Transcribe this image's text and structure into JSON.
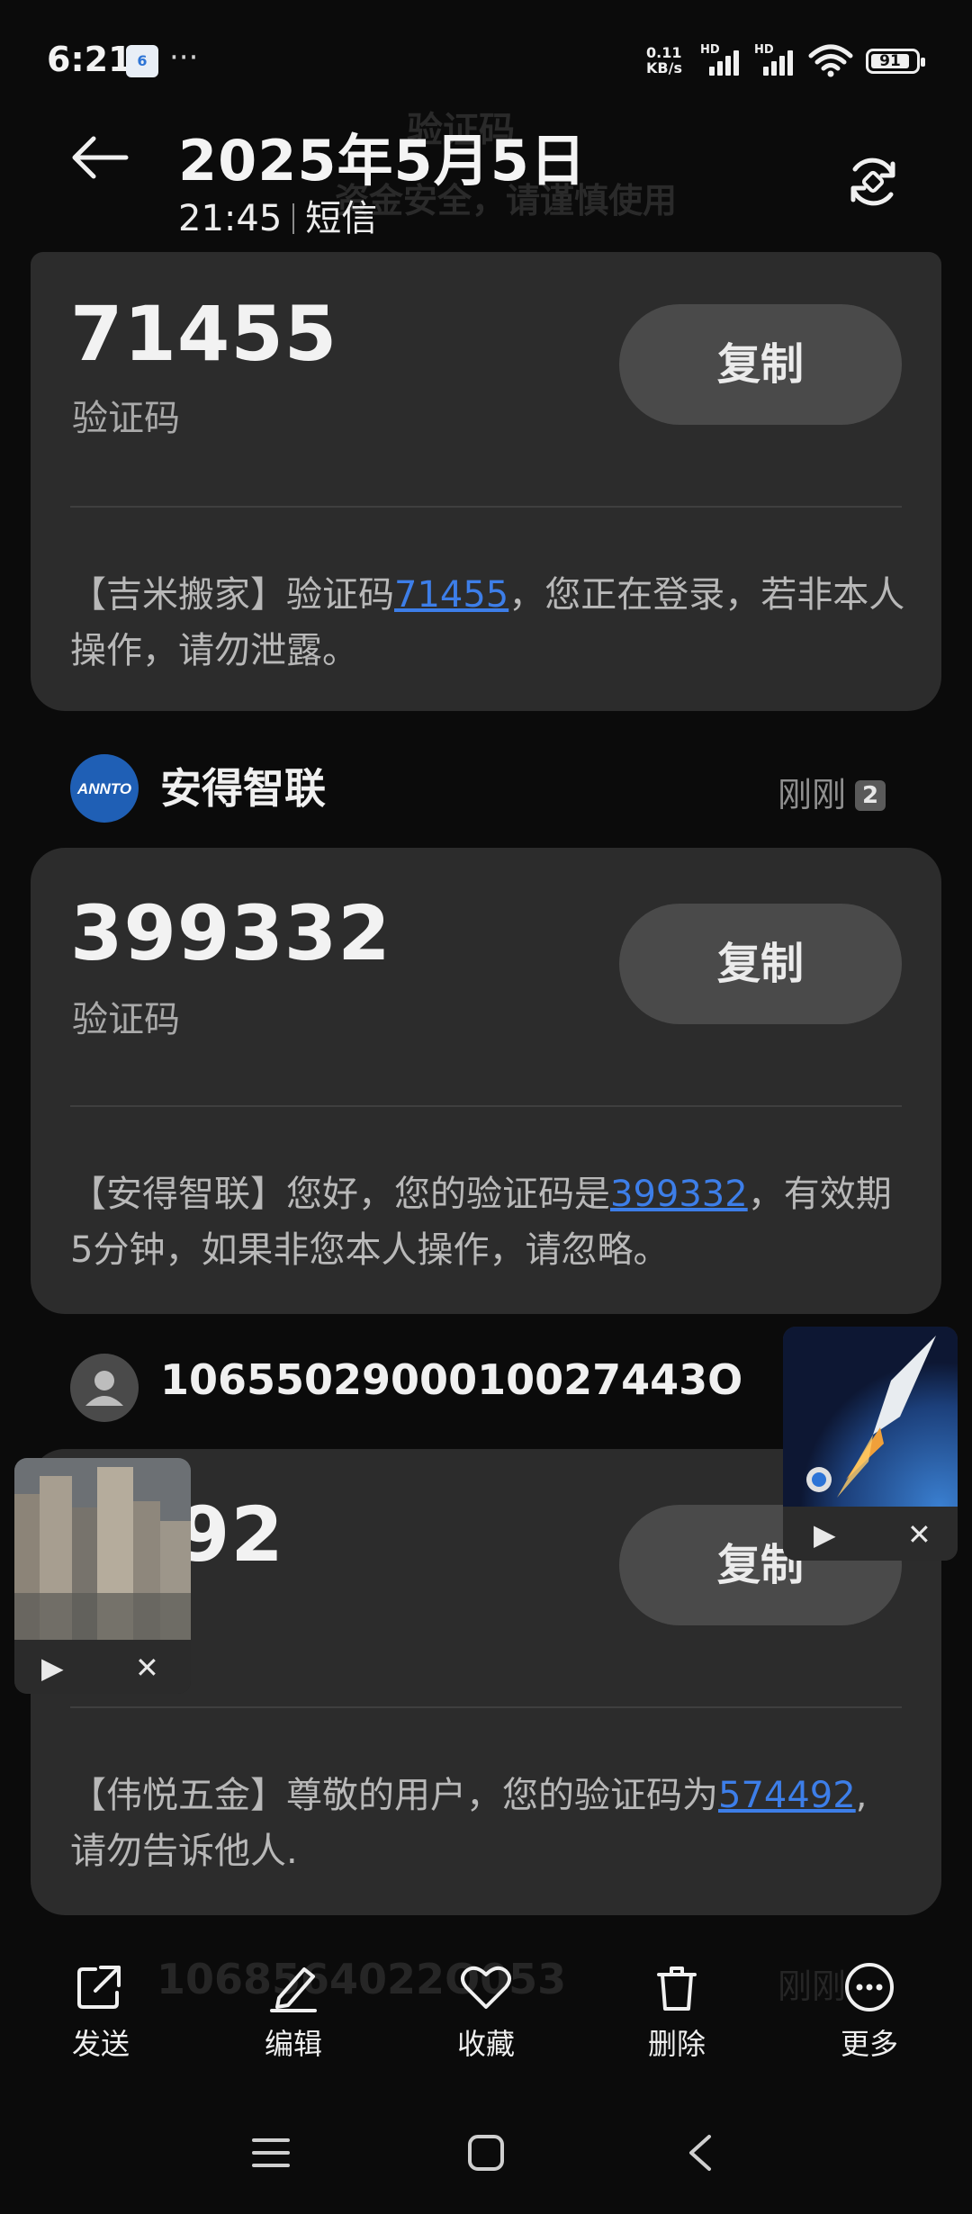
{
  "status_bar": {
    "time": "6:21",
    "mini_badge": "6",
    "more_dots": "···",
    "net_speed_value": "0.11",
    "net_speed_unit": "KB/s",
    "hd1": "HD",
    "hd2": "HD",
    "battery": "91"
  },
  "header": {
    "ghost_title": "验证码",
    "ghost_subtitle": "资金安全，请谨慎使用",
    "date": "2025年5月5日",
    "time": "21:45",
    "channel": "短信"
  },
  "cards": [
    {
      "code": "71455",
      "code_label": "验证码",
      "copy_label": "复制",
      "msg_prefix": "【吉米搬家】验证码",
      "msg_link": "71455",
      "msg_suffix": "，您正在登录，若非本人操作，请勿泄露。"
    },
    {
      "code": "399332",
      "code_label": "验证码",
      "copy_label": "复制",
      "msg_prefix": "【安得智联】您好，您的验证码是",
      "msg_link": "399332",
      "msg_suffix": "，有效期5分钟，如果非您本人操作，请忽略。"
    },
    {
      "code": "4492",
      "code_label": "",
      "copy_label": "复制",
      "msg_prefix": "【伟悦五金】尊敬的用户，您的验证码为",
      "msg_link": "574492",
      "msg_suffix": ", 请勿告诉他人."
    }
  ],
  "senders": [
    {
      "name": "安得智联",
      "logo_text": "ANNTO",
      "time": "刚刚",
      "count": "2"
    },
    {
      "name": "1065502900010027443O",
      "time": ""
    }
  ],
  "next_sender_ghost": "1068564022O053",
  "next_sender_time_ghost": "刚刚",
  "actions": [
    {
      "label": "发送",
      "icon": "share-icon"
    },
    {
      "label": "编辑",
      "icon": "edit-icon"
    },
    {
      "label": "收藏",
      "icon": "heart-icon"
    },
    {
      "label": "删除",
      "icon": "trash-icon"
    },
    {
      "label": "更多",
      "icon": "more-icon"
    }
  ],
  "floating_windows": [
    {
      "name": "city-video",
      "play": "▶",
      "close": "✕"
    },
    {
      "name": "rocket-video",
      "play": "▶",
      "close": "✕"
    }
  ],
  "colors": {
    "link": "#3d7ee8",
    "card": "#2c2c2c",
    "button": "#4a4a4a",
    "background": "#0b0b0b"
  }
}
